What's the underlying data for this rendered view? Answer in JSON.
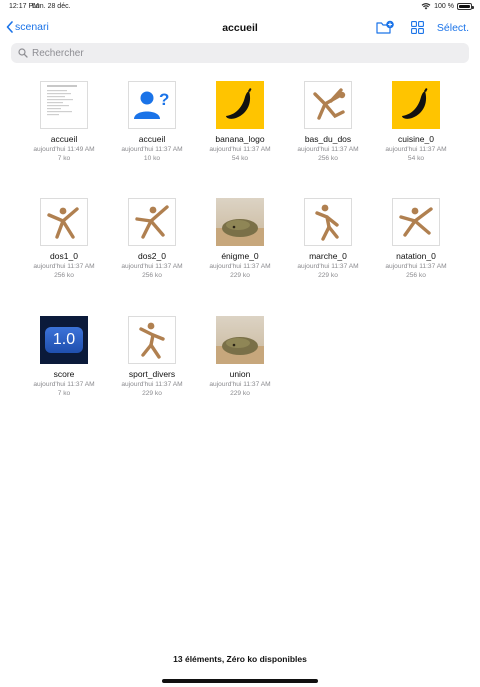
{
  "status_bar": {
    "time": "12:17 PM",
    "date": "Lun. 28 déc.",
    "battery": "100 %",
    "battery_level": 1.0
  },
  "nav": {
    "back_label": "scenari",
    "title": "accueil",
    "select_label": "Sélect."
  },
  "search": {
    "placeholder": "Rechercher"
  },
  "files": [
    {
      "name": "accueil",
      "date": "aujourd'hui 11:49 AM",
      "size": "7 ko",
      "type": "document"
    },
    {
      "name": "accueil",
      "date": "aujourd'hui 11:37 AM",
      "size": "10 ko",
      "type": "unknown"
    },
    {
      "name": "banana_logo",
      "date": "aujourd'hui 11:37 AM",
      "size": "54 ko",
      "type": "banana"
    },
    {
      "name": "bas_du_dos",
      "date": "aujourd'hui 11:37 AM",
      "size": "256 ko",
      "type": "mannequin"
    },
    {
      "name": "cuisine_0",
      "date": "aujourd'hui 11:37 AM",
      "size": "54 ko",
      "type": "banana"
    },
    {
      "name": "dos1_0",
      "date": "aujourd'hui 11:37 AM",
      "size": "256 ko",
      "type": "mannequin"
    },
    {
      "name": "dos2_0",
      "date": "aujourd'hui 11:37 AM",
      "size": "256 ko",
      "type": "mannequin"
    },
    {
      "name": "énigme_0",
      "date": "aujourd'hui 11:37 AM",
      "size": "229 ko",
      "type": "photo"
    },
    {
      "name": "marche_0",
      "date": "aujourd'hui 11:37 AM",
      "size": "229 ko",
      "type": "mannequin"
    },
    {
      "name": "natation_0",
      "date": "aujourd'hui 11:37 AM",
      "size": "256 ko",
      "type": "mannequin"
    },
    {
      "name": "score",
      "date": "aujourd'hui 11:37 AM",
      "size": "7 ko",
      "type": "score",
      "badge": "1.0"
    },
    {
      "name": "sport_divers",
      "date": "aujourd'hui 11:37 AM",
      "size": "229 ko",
      "type": "mannequin"
    },
    {
      "name": "union",
      "date": "aujourd'hui 11:37 AM",
      "size": "229 ko",
      "type": "photo"
    }
  ],
  "footer": {
    "summary": "13 éléments, Zéro ko disponibles"
  },
  "colors": {
    "accent": "#1a73e8",
    "banana_bg": "#ffc400",
    "score_bg": "#0b1a3a"
  }
}
